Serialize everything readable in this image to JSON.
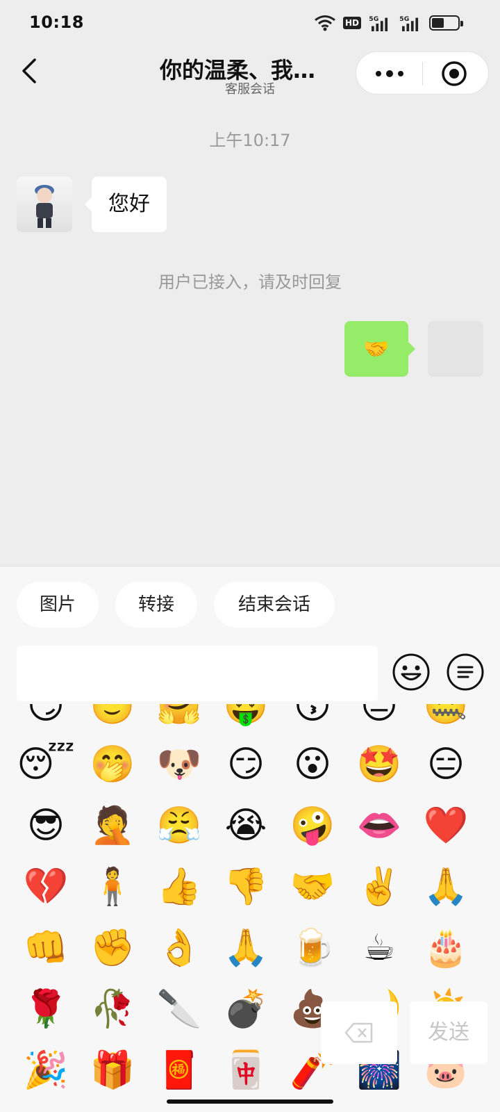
{
  "status_bar": {
    "time": "10:18",
    "hd_label": "HD",
    "signal_1_label": "5G",
    "signal_2_label": "5G",
    "battery_level": 0.42
  },
  "nav": {
    "title": "你的温柔、我…",
    "subtitle": "客服会话"
  },
  "chat": {
    "timestamp": "上午10:17",
    "messages": [
      {
        "side": "left",
        "text": "您好"
      },
      {
        "side": "right",
        "text": "🤝"
      }
    ],
    "system_notice": "用户已接入，请及时回复"
  },
  "quick_actions": [
    {
      "label": "图片"
    },
    {
      "label": "转接"
    },
    {
      "label": "结束会话"
    }
  ],
  "composer": {
    "input_value": "",
    "send_label": "发送"
  },
  "emoji_rows": [
    [
      "😏",
      "🙂",
      "🤗",
      "🤑",
      "😙",
      "😐",
      "🤐"
    ],
    [
      "😴",
      "🤭",
      "🐶",
      "😏",
      "😮",
      "🤩",
      "😑"
    ],
    [
      "😎",
      "🤦",
      "😤",
      "😭",
      "🤪",
      "👄",
      "❤️"
    ],
    [
      "💔",
      "🧍",
      "👍",
      "👎",
      "🤝",
      "✌️",
      "🙏"
    ],
    [
      "👊",
      "✊",
      "👌",
      "🙏",
      "🍺",
      "☕",
      "🎂"
    ],
    [
      "🌹",
      "🥀",
      "🔪",
      "💣",
      "💩",
      "🌙",
      "☀️"
    ],
    [
      "🎉",
      "🎁",
      "🧧",
      "🀄",
      "🧨",
      "🎆",
      "🐷"
    ]
  ],
  "colors": {
    "background": "#ededed",
    "bubble_self": "#95ec69",
    "bubble_other": "#ffffff",
    "panel": "#f7f7f7",
    "muted_text": "#999999"
  }
}
